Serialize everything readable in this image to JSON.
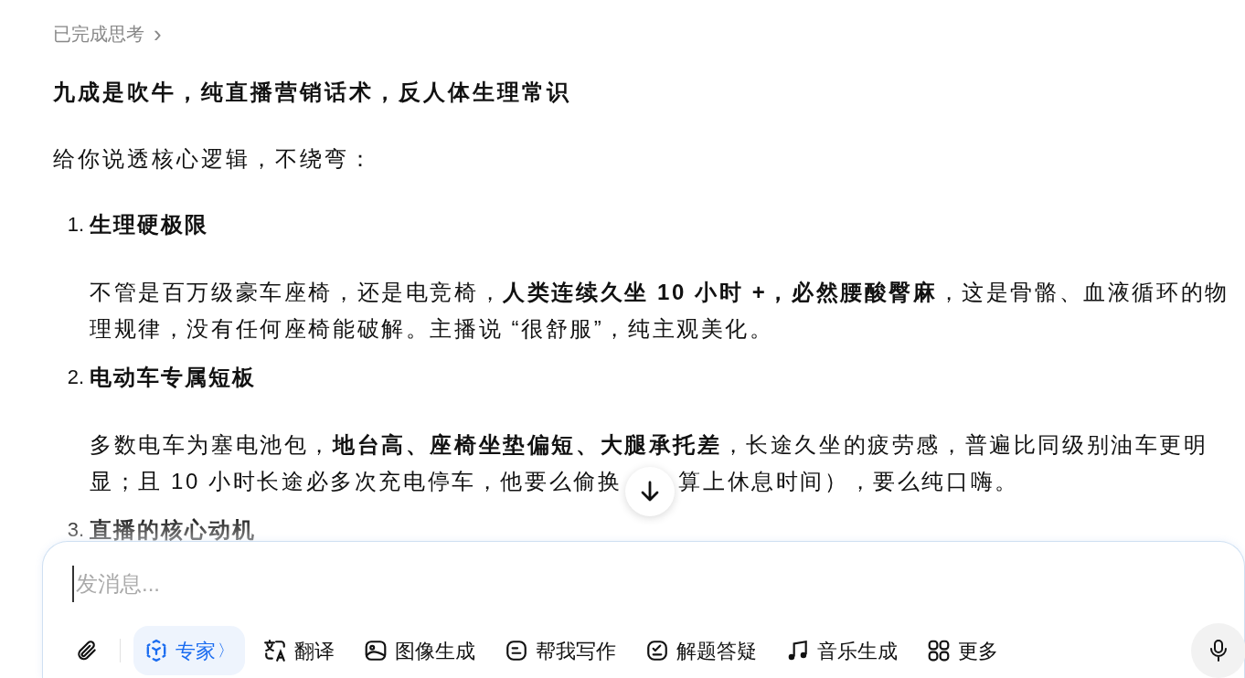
{
  "thinking": {
    "label": "已完成思考",
    "chevron": "›"
  },
  "answer": {
    "headline": "九成是吹牛，纯直播营销话术，反人体生理常识",
    "intro": "给你说透核心逻辑，不绕弯：",
    "points": [
      {
        "number": "1.",
        "title": "生理硬极限",
        "body": "不管是百万级豪车座椅，还是电竞椅，**人类连续久坐 10 小时 +，必然腰酸臀麻**，这是骨骼、血液循环的物理规律，没有任何座椅能破解。主播说 “很舒服”，纯主观美化。"
      },
      {
        "number": "2.",
        "title": "电动车专属短板",
        "body_lines": [
          "多数电车为塞电池包，**地台高、座椅坐垫偏短、大腿承托差**，长途久坐的疲劳感，普遍比同级别油车更明",
          "显；且 10 小时长途必多次充电停车，他要么偷换"
        ],
        "body_after_button": "算上休息时间），要么纯口嗨。"
      },
      {
        "number": "3.",
        "title": "直播的核心动机"
      }
    ]
  },
  "composer": {
    "placeholder": "发消息...",
    "tools": [
      {
        "kind": "expert",
        "label": "专家",
        "chevron": "〉",
        "selected": true
      },
      {
        "kind": "translate",
        "label": "翻译",
        "selected": false
      },
      {
        "kind": "image",
        "label": "图像生成",
        "selected": false
      },
      {
        "kind": "write",
        "label": "帮我写作",
        "selected": false
      },
      {
        "kind": "solve",
        "label": "解题答疑",
        "selected": false
      },
      {
        "kind": "music",
        "label": "音乐生成",
        "selected": false
      },
      {
        "kind": "more",
        "label": "更多",
        "selected": false
      }
    ]
  }
}
